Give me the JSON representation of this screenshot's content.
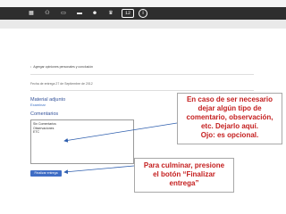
{
  "toolbar": {
    "icons": [
      {
        "name": "calendar-icon",
        "glyph": "▦"
      },
      {
        "name": "people-icon",
        "glyph": "⚇"
      },
      {
        "name": "screen-icon",
        "glyph": "▭"
      },
      {
        "name": "folder-icon",
        "glyph": "▬"
      },
      {
        "name": "group-icon",
        "glyph": "☻"
      },
      {
        "name": "badge-icon",
        "glyph": "♛"
      },
      {
        "name": "code-icon",
        "glyph": "12"
      },
      {
        "name": "info-icon",
        "glyph": "i"
      }
    ]
  },
  "assignment": {
    "link_text": "Agregar opiniones personales y conclusión",
    "due_date": "Fecha de entrega 27 de Septiembre de 2012"
  },
  "attachment": {
    "title": "Material adjunto",
    "browse_link": "Examinar"
  },
  "comments": {
    "title": "Comentarios",
    "lines": [
      "Sin Comentarios",
      "Observaciones",
      "ETC"
    ]
  },
  "finish_button": {
    "label": "Finalizar entrega"
  },
  "callouts": {
    "comment_note": [
      "En caso de ser necesario",
      "dejar algún tipo de",
      "comentario, observación,",
      "etc. Dejarlo aquí.",
      "Ojo: es opcional."
    ],
    "finish_note": [
      "Para culminar, presione",
      "el botón “Finalizar",
      "entrega”"
    ]
  },
  "colors": {
    "toolbar_bg": "#2e2e2e",
    "heading_blue": "#33529a",
    "button_blue": "#3f6dc5",
    "callout_red": "#c41e1e"
  }
}
